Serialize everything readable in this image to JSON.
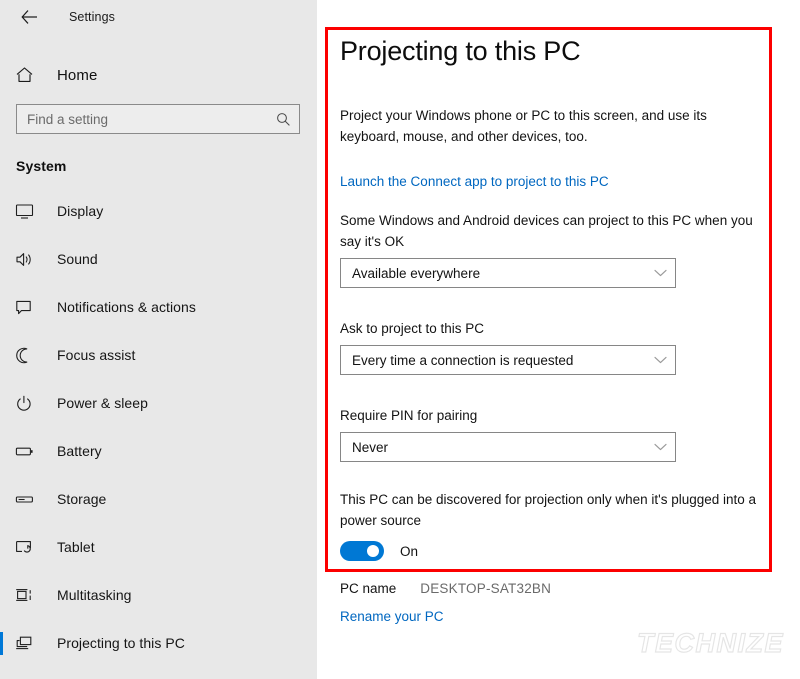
{
  "window": {
    "title": "Settings",
    "back_icon": "back-arrow-icon"
  },
  "sidebar": {
    "home": {
      "label": "Home",
      "icon": "home-icon"
    },
    "search": {
      "placeholder": "Find a setting",
      "value": "",
      "icon": "search-icon"
    },
    "category": "System",
    "items": [
      {
        "label": "Display",
        "icon": "monitor-icon",
        "selected": false
      },
      {
        "label": "Sound",
        "icon": "speaker-icon",
        "selected": false
      },
      {
        "label": "Notifications & actions",
        "icon": "notification-icon",
        "selected": false
      },
      {
        "label": "Focus assist",
        "icon": "moon-icon",
        "selected": false
      },
      {
        "label": "Power & sleep",
        "icon": "power-icon",
        "selected": false
      },
      {
        "label": "Battery",
        "icon": "battery-icon",
        "selected": false
      },
      {
        "label": "Storage",
        "icon": "storage-icon",
        "selected": false
      },
      {
        "label": "Tablet",
        "icon": "tablet-icon",
        "selected": false
      },
      {
        "label": "Multitasking",
        "icon": "multitasking-icon",
        "selected": false
      },
      {
        "label": "Projecting to this PC",
        "icon": "projecting-icon",
        "selected": true
      }
    ]
  },
  "main": {
    "title": "Projecting to this PC",
    "intro": "Project your Windows phone or PC to this screen, and use its keyboard, mouse, and other devices, too.",
    "connect_link": "Launch the Connect app to project to this PC",
    "settings": [
      {
        "label": "Some Windows and Android devices can project to this PC when you say it's OK",
        "value": "Available everywhere",
        "name": "project-availability"
      },
      {
        "label": "Ask to project to this PC",
        "value": "Every time a connection is requested",
        "name": "ask-to-project"
      },
      {
        "label": "Require PIN for pairing",
        "value": "Never",
        "name": "require-pin"
      }
    ],
    "power_setting": {
      "label": "This PC can be discovered for projection only when it's plugged into a power source",
      "toggle_state": "On"
    },
    "pc_name": {
      "label": "PC name",
      "value": "DESKTOP-SAT32BN",
      "rename_link": "Rename your PC"
    }
  },
  "annotation": {
    "box_color": "#fc0000"
  },
  "watermark": {
    "text": "TECHNIZE"
  },
  "colors": {
    "accent": "#0078d4",
    "link": "#0067c0",
    "sidebar_bg": "#e8e8e8",
    "content_bg": "#ffffff",
    "selection_bar": "#0078d7"
  }
}
